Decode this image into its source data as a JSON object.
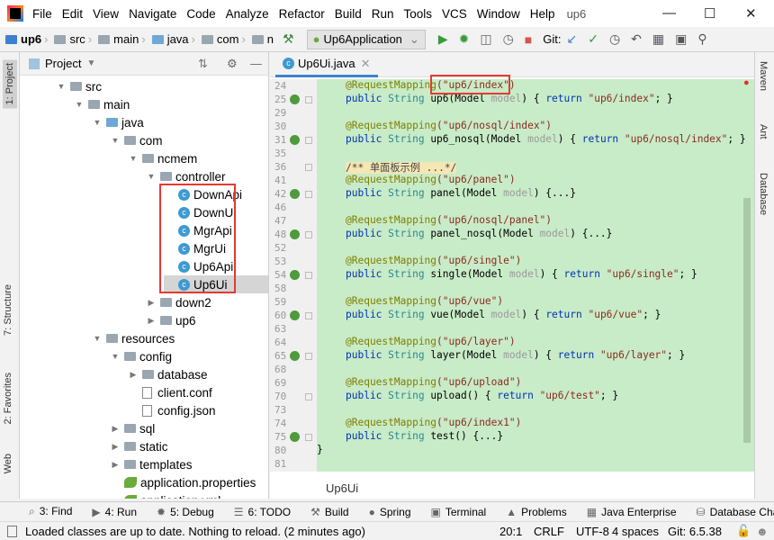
{
  "menu": {
    "items": [
      "File",
      "Edit",
      "View",
      "Navigate",
      "Code",
      "Analyze",
      "Refactor",
      "Build",
      "Run",
      "Tools",
      "VCS",
      "Window",
      "Help"
    ],
    "project": "up6"
  },
  "nav": {
    "crumbs": [
      "up6",
      "src",
      "main",
      "java",
      "com",
      "n"
    ],
    "run_config": "Up6Application",
    "git_label": "Git:"
  },
  "left_tabs": [
    "1: Project",
    "7: Structure",
    "2: Favorites",
    "Web"
  ],
  "right_tabs": [
    "Maven",
    "Ant",
    "Database"
  ],
  "project_panel": {
    "title": "Project",
    "tree": [
      {
        "label": "src",
        "depth": 0,
        "kind": "folder",
        "open": true
      },
      {
        "label": "main",
        "depth": 1,
        "kind": "folder",
        "open": true
      },
      {
        "label": "java",
        "depth": 2,
        "kind": "srcfolder",
        "open": true
      },
      {
        "label": "com",
        "depth": 3,
        "kind": "folder",
        "open": true
      },
      {
        "label": "ncmem",
        "depth": 4,
        "kind": "folder",
        "open": true
      },
      {
        "label": "controller",
        "depth": 5,
        "kind": "folder",
        "open": true
      },
      {
        "label": "DownApi",
        "depth": 6,
        "kind": "class"
      },
      {
        "label": "DownUi",
        "depth": 6,
        "kind": "class"
      },
      {
        "label": "MgrApi",
        "depth": 6,
        "kind": "class"
      },
      {
        "label": "MgrUi",
        "depth": 6,
        "kind": "class"
      },
      {
        "label": "Up6Api",
        "depth": 6,
        "kind": "class"
      },
      {
        "label": "Up6Ui",
        "depth": 6,
        "kind": "class",
        "selected": true
      },
      {
        "label": "down2",
        "depth": 5,
        "kind": "folder",
        "open": false
      },
      {
        "label": "up6",
        "depth": 5,
        "kind": "folder",
        "open": false
      },
      {
        "label": "resources",
        "depth": 2,
        "kind": "folder",
        "open": true
      },
      {
        "label": "config",
        "depth": 3,
        "kind": "folder",
        "open": true
      },
      {
        "label": "database",
        "depth": 4,
        "kind": "folder",
        "open": false
      },
      {
        "label": "client.conf",
        "depth": 4,
        "kind": "file"
      },
      {
        "label": "config.json",
        "depth": 4,
        "kind": "file"
      },
      {
        "label": "sql",
        "depth": 3,
        "kind": "folder",
        "open": false
      },
      {
        "label": "static",
        "depth": 3,
        "kind": "folder",
        "open": false
      },
      {
        "label": "templates",
        "depth": 3,
        "kind": "folder",
        "open": false
      },
      {
        "label": "application.properties",
        "depth": 3,
        "kind": "spring"
      },
      {
        "label": "application.yml",
        "depth": 3,
        "kind": "spring"
      }
    ]
  },
  "editor": {
    "tab": "Up6Ui.java",
    "breadcrumb": "Up6Ui",
    "lines": [
      {
        "n": "24",
        "tokens": [
          [
            "@RequestMapping",
            "a"
          ],
          [
            "(\"up6/index\")",
            "s"
          ]
        ]
      },
      {
        "n": "25",
        "icon": true,
        "fold": true,
        "tokens": [
          [
            "public ",
            "k"
          ],
          [
            "String ",
            "t"
          ],
          [
            "up6(Model ",
            "n"
          ],
          [
            "model",
            "p"
          ],
          [
            ") { ",
            "n"
          ],
          [
            "return ",
            "k"
          ],
          [
            "\"up6/index\"",
            "s"
          ],
          [
            "; }",
            "n"
          ]
        ]
      },
      {
        "n": "29",
        "tokens": []
      },
      {
        "n": "30",
        "tokens": [
          [
            "@RequestMapping",
            "a"
          ],
          [
            "(\"up6/nosql/index\")",
            "s"
          ]
        ]
      },
      {
        "n": "31",
        "icon": true,
        "fold": true,
        "tokens": [
          [
            "public ",
            "k"
          ],
          [
            "String ",
            "t"
          ],
          [
            "up6_nosql(Model ",
            "n"
          ],
          [
            "model",
            "p"
          ],
          [
            ") { ",
            "n"
          ],
          [
            "return ",
            "k"
          ],
          [
            "\"up6/nosql/index\"",
            "s"
          ],
          [
            "; }",
            "n"
          ]
        ]
      },
      {
        "n": "35",
        "tokens": []
      },
      {
        "n": "36",
        "fold": true,
        "tokens": [
          [
            "/** 单面板示例 ...*/",
            "c"
          ]
        ]
      },
      {
        "n": "41",
        "tokens": [
          [
            "@RequestMapping",
            "a"
          ],
          [
            "(\"up6/panel\")",
            "s"
          ]
        ]
      },
      {
        "n": "42",
        "icon": true,
        "fold": true,
        "tokens": [
          [
            "public ",
            "k"
          ],
          [
            "String ",
            "t"
          ],
          [
            "panel(Model ",
            "n"
          ],
          [
            "model",
            "p"
          ],
          [
            ") {...}",
            "n"
          ]
        ]
      },
      {
        "n": "46",
        "tokens": []
      },
      {
        "n": "47",
        "tokens": [
          [
            "@RequestMapping",
            "a"
          ],
          [
            "(\"up6/nosql/panel\")",
            "s"
          ]
        ]
      },
      {
        "n": "48",
        "icon": true,
        "fold": true,
        "tokens": [
          [
            "public ",
            "k"
          ],
          [
            "String ",
            "t"
          ],
          [
            "panel_nosql(Model ",
            "n"
          ],
          [
            "model",
            "p"
          ],
          [
            ") {...}",
            "n"
          ]
        ]
      },
      {
        "n": "52",
        "tokens": []
      },
      {
        "n": "53",
        "tokens": [
          [
            "@RequestMapping",
            "a"
          ],
          [
            "(\"up6/single\")",
            "s"
          ]
        ]
      },
      {
        "n": "54",
        "icon": true,
        "fold": true,
        "tokens": [
          [
            "public ",
            "k"
          ],
          [
            "String ",
            "t"
          ],
          [
            "single(Model ",
            "n"
          ],
          [
            "model",
            "p"
          ],
          [
            ") { ",
            "n"
          ],
          [
            "return ",
            "k"
          ],
          [
            "\"up6/single\"",
            "s"
          ],
          [
            "; }",
            "n"
          ]
        ]
      },
      {
        "n": "58",
        "tokens": []
      },
      {
        "n": "59",
        "tokens": [
          [
            "@RequestMapping",
            "a"
          ],
          [
            "(\"up6/vue\")",
            "s"
          ]
        ]
      },
      {
        "n": "60",
        "icon": true,
        "fold": true,
        "tokens": [
          [
            "public ",
            "k"
          ],
          [
            "String ",
            "t"
          ],
          [
            "vue(Model ",
            "n"
          ],
          [
            "model",
            "p"
          ],
          [
            ") { ",
            "n"
          ],
          [
            "return ",
            "k"
          ],
          [
            "\"up6/vue\"",
            "s"
          ],
          [
            "; }",
            "n"
          ]
        ]
      },
      {
        "n": "63",
        "tokens": []
      },
      {
        "n": "64",
        "tokens": [
          [
            "@RequestMapping",
            "a"
          ],
          [
            "(\"up6/layer\")",
            "s"
          ]
        ]
      },
      {
        "n": "65",
        "icon": true,
        "fold": true,
        "tokens": [
          [
            "public ",
            "k"
          ],
          [
            "String ",
            "t"
          ],
          [
            "layer(Model ",
            "n"
          ],
          [
            "model",
            "p"
          ],
          [
            ") { ",
            "n"
          ],
          [
            "return ",
            "k"
          ],
          [
            "\"up6/layer\"",
            "s"
          ],
          [
            "; }",
            "n"
          ]
        ]
      },
      {
        "n": "68",
        "tokens": []
      },
      {
        "n": "69",
        "tokens": [
          [
            "@RequestMapping",
            "a"
          ],
          [
            "(\"up6/upload\")",
            "s"
          ]
        ]
      },
      {
        "n": "70",
        "fold": true,
        "tokens": [
          [
            "public ",
            "k"
          ],
          [
            "String ",
            "t"
          ],
          [
            "upload() { ",
            "n"
          ],
          [
            "return ",
            "k"
          ],
          [
            "\"up6/test\"",
            "s"
          ],
          [
            "; }",
            "n"
          ]
        ]
      },
      {
        "n": "73",
        "tokens": []
      },
      {
        "n": "74",
        "tokens": [
          [
            "@RequestMapping",
            "a"
          ],
          [
            "(\"up6/index1\")",
            "s"
          ]
        ]
      },
      {
        "n": "75",
        "icon": true,
        "fold": true,
        "tokens": [
          [
            "public ",
            "k"
          ],
          [
            "String ",
            "t"
          ],
          [
            "test() {...}",
            "n"
          ]
        ]
      },
      {
        "n": "80",
        "indent": 0,
        "tokens": [
          [
            "}",
            "n"
          ]
        ]
      },
      {
        "n": "81",
        "tokens": []
      }
    ]
  },
  "tool_windows": [
    {
      "icon": "search-icon",
      "label": "3: Find"
    },
    {
      "icon": "run-icon",
      "label": "4: Run"
    },
    {
      "icon": "bug-icon",
      "label": "5: Debug"
    },
    {
      "icon": "list-icon",
      "label": "6: TODO"
    },
    {
      "icon": "hammer-icon",
      "label": "Build"
    },
    {
      "icon": "spring-icon",
      "label": "Spring"
    },
    {
      "icon": "terminal-icon",
      "label": "Terminal"
    },
    {
      "icon": "warning-icon",
      "label": "Problems"
    },
    {
      "icon": "java-enterprise-icon",
      "label": "Java Enterprise"
    },
    {
      "icon": "database-icon",
      "label": "Database Changes"
    }
  ],
  "status": {
    "message": "Loaded classes are up to date. Nothing to reload. (2 minutes ago)",
    "position": "20:1",
    "line_sep": "CRLF",
    "encoding": "UTF-8",
    "indent": "4 spaces",
    "git": "Git: 6.5.38"
  },
  "colors": {
    "editor_bg": "#c8ebc8",
    "highlight_box": "#e53935",
    "accent": "#4083c9"
  }
}
